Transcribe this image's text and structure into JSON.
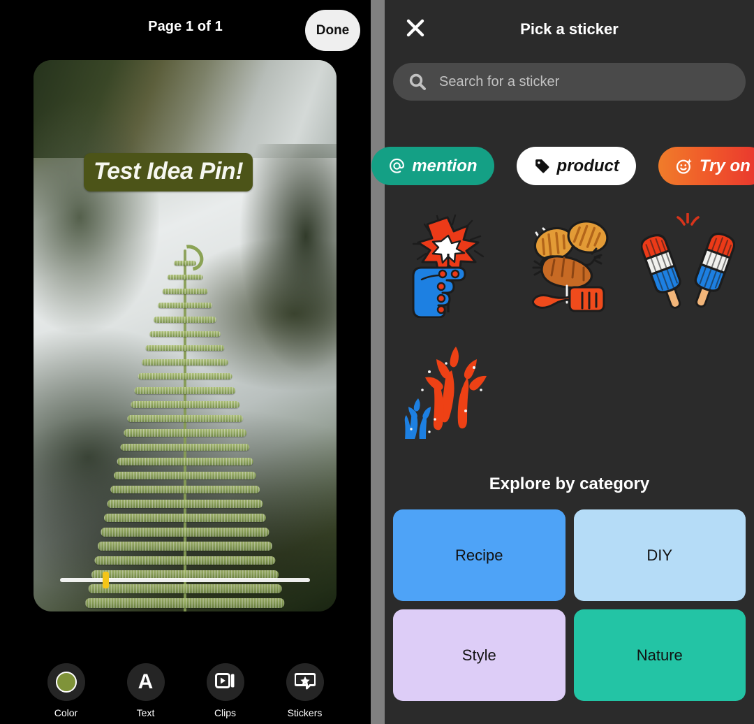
{
  "editor": {
    "page_indicator": "Page 1 of 1",
    "done_label": "Done",
    "pin_text_overlay": "Test Idea Pin!",
    "scrubber_position_percent": 17,
    "toolbar": [
      {
        "label": "Color",
        "icon": "color-swatch-icon",
        "color": "#7f9339"
      },
      {
        "label": "Text",
        "icon": "text-a-icon"
      },
      {
        "label": "Clips",
        "icon": "clips-icon"
      },
      {
        "label": "Stickers",
        "icon": "sticker-star-icon"
      }
    ]
  },
  "sticker_sheet": {
    "close_icon": "close-icon",
    "title": "Pick a sticker",
    "search": {
      "icon": "search-icon",
      "value": "",
      "placeholder": "Search for a sticker"
    },
    "chips": [
      {
        "label": "mention",
        "icon": "at-sign-icon",
        "bg": "#14a085",
        "fg": "#ffffff"
      },
      {
        "label": "product",
        "icon": "price-tag-icon",
        "bg": "#ffffff",
        "fg": "#111111"
      },
      {
        "label": "Try on",
        "icon": "smiley-sparkle-icon",
        "bg": "#f0612a",
        "fg": "#ffffff"
      }
    ],
    "stickers": [
      {
        "name": "hand-holding-firecracker-sticker"
      },
      {
        "name": "bbq-sausage-spatula-sticker"
      },
      {
        "name": "red-white-blue-popsicles-sticker"
      },
      {
        "name": "fireworks-sticker"
      }
    ],
    "explore_title": "Explore by category",
    "categories": [
      {
        "label": "Recipe",
        "color": "#4ea3f7"
      },
      {
        "label": "DIY",
        "color": "#b5dcf7"
      },
      {
        "label": "Style",
        "color": "#ddcdf7"
      },
      {
        "label": "Nature",
        "color": "#23c4a5"
      }
    ]
  }
}
